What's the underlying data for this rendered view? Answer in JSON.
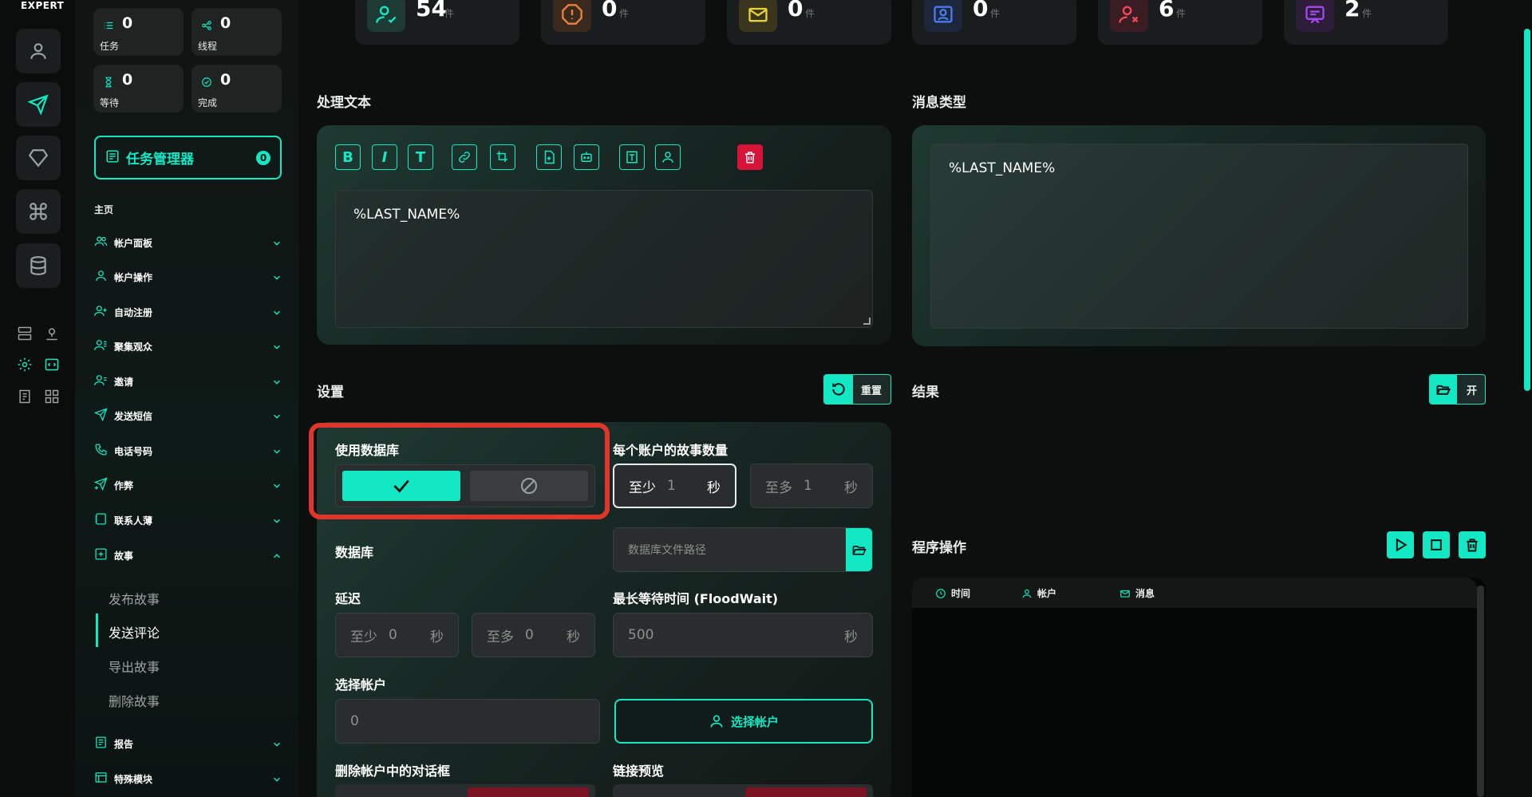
{
  "brand": "EXPERT",
  "icons": {
    "rail": [
      "user-icon",
      "send-icon",
      "diamond-icon",
      "command-icon",
      "database-icon"
    ],
    "mini": [
      "server-icon",
      "map-pin-icon",
      "gear-icon",
      "code-icon",
      "notes-icon",
      "apps-icon"
    ]
  },
  "stats": {
    "tasks": {
      "value": "0",
      "label": "任务"
    },
    "threads": {
      "value": "0",
      "label": "线程"
    },
    "waiting": {
      "value": "0",
      "label": "等待"
    },
    "done": {
      "value": "0",
      "label": "完成"
    }
  },
  "task_manager": {
    "label": "任务管理器",
    "badge": "0"
  },
  "nav": {
    "home": "主页",
    "items": [
      {
        "label": "帐户面板"
      },
      {
        "label": "帐户操作"
      },
      {
        "label": "自动注册"
      },
      {
        "label": "聚集观众"
      },
      {
        "label": "邀请"
      },
      {
        "label": "发送短信"
      },
      {
        "label": "电话号码"
      },
      {
        "label": "作弊"
      },
      {
        "label": "联系人薄"
      },
      {
        "label": "故事"
      },
      {
        "label": "报告"
      },
      {
        "label": "特殊模块"
      }
    ],
    "story_sub": [
      "发布故事",
      "发送评论",
      "导出故事",
      "删除故事"
    ]
  },
  "top_cards": [
    {
      "value": "54",
      "unit": "件",
      "color": "#12e8c4"
    },
    {
      "value": "0",
      "unit": "件",
      "color": "#f0803c"
    },
    {
      "value": "0",
      "unit": "件",
      "color": "#e8d23a"
    },
    {
      "value": "0",
      "unit": "件",
      "color": "#4a7cf0"
    },
    {
      "value": "6",
      "unit": "件",
      "color": "#f04a5a"
    },
    {
      "value": "2",
      "unit": "件",
      "color": "#a04af0"
    }
  ],
  "process_text": {
    "title": "处理文本",
    "toolbar": {
      "bold": "B",
      "italic": "I",
      "text": "T"
    },
    "content": "%LAST_NAME%"
  },
  "message_type": {
    "title": "消息类型",
    "content": "%LAST_NAME%"
  },
  "settings": {
    "title": "设置",
    "reset_label": "重置",
    "use_db": "使用数据库",
    "stories_per_account": "每个账户的故事数量",
    "story_min": {
      "prefix": "至少",
      "value": "1",
      "suffix": "秒"
    },
    "story_max": {
      "prefix": "至多",
      "value": "1",
      "suffix": "秒"
    },
    "database": "数据库",
    "db_path_placeholder": "数据库文件路径",
    "delay": "延迟",
    "delay_min": {
      "prefix": "至少",
      "value": "0",
      "suffix": "秒"
    },
    "delay_max": {
      "prefix": "至多",
      "value": "0",
      "suffix": "秒"
    },
    "floodwait": "最长等待时间 (FloodWait)",
    "floodwait_value": {
      "value": "500",
      "suffix": "秒"
    },
    "select_account": "选择帐户",
    "select_account_value": "0",
    "select_account_btn": "选择帐户",
    "delete_dialogs": "删除帐户中的对话框",
    "link_preview": "链接预览"
  },
  "result": {
    "title": "结果",
    "open_label": "开"
  },
  "program_ops": {
    "title": "程序操作",
    "columns": [
      "时间",
      "帐户",
      "消息"
    ]
  }
}
